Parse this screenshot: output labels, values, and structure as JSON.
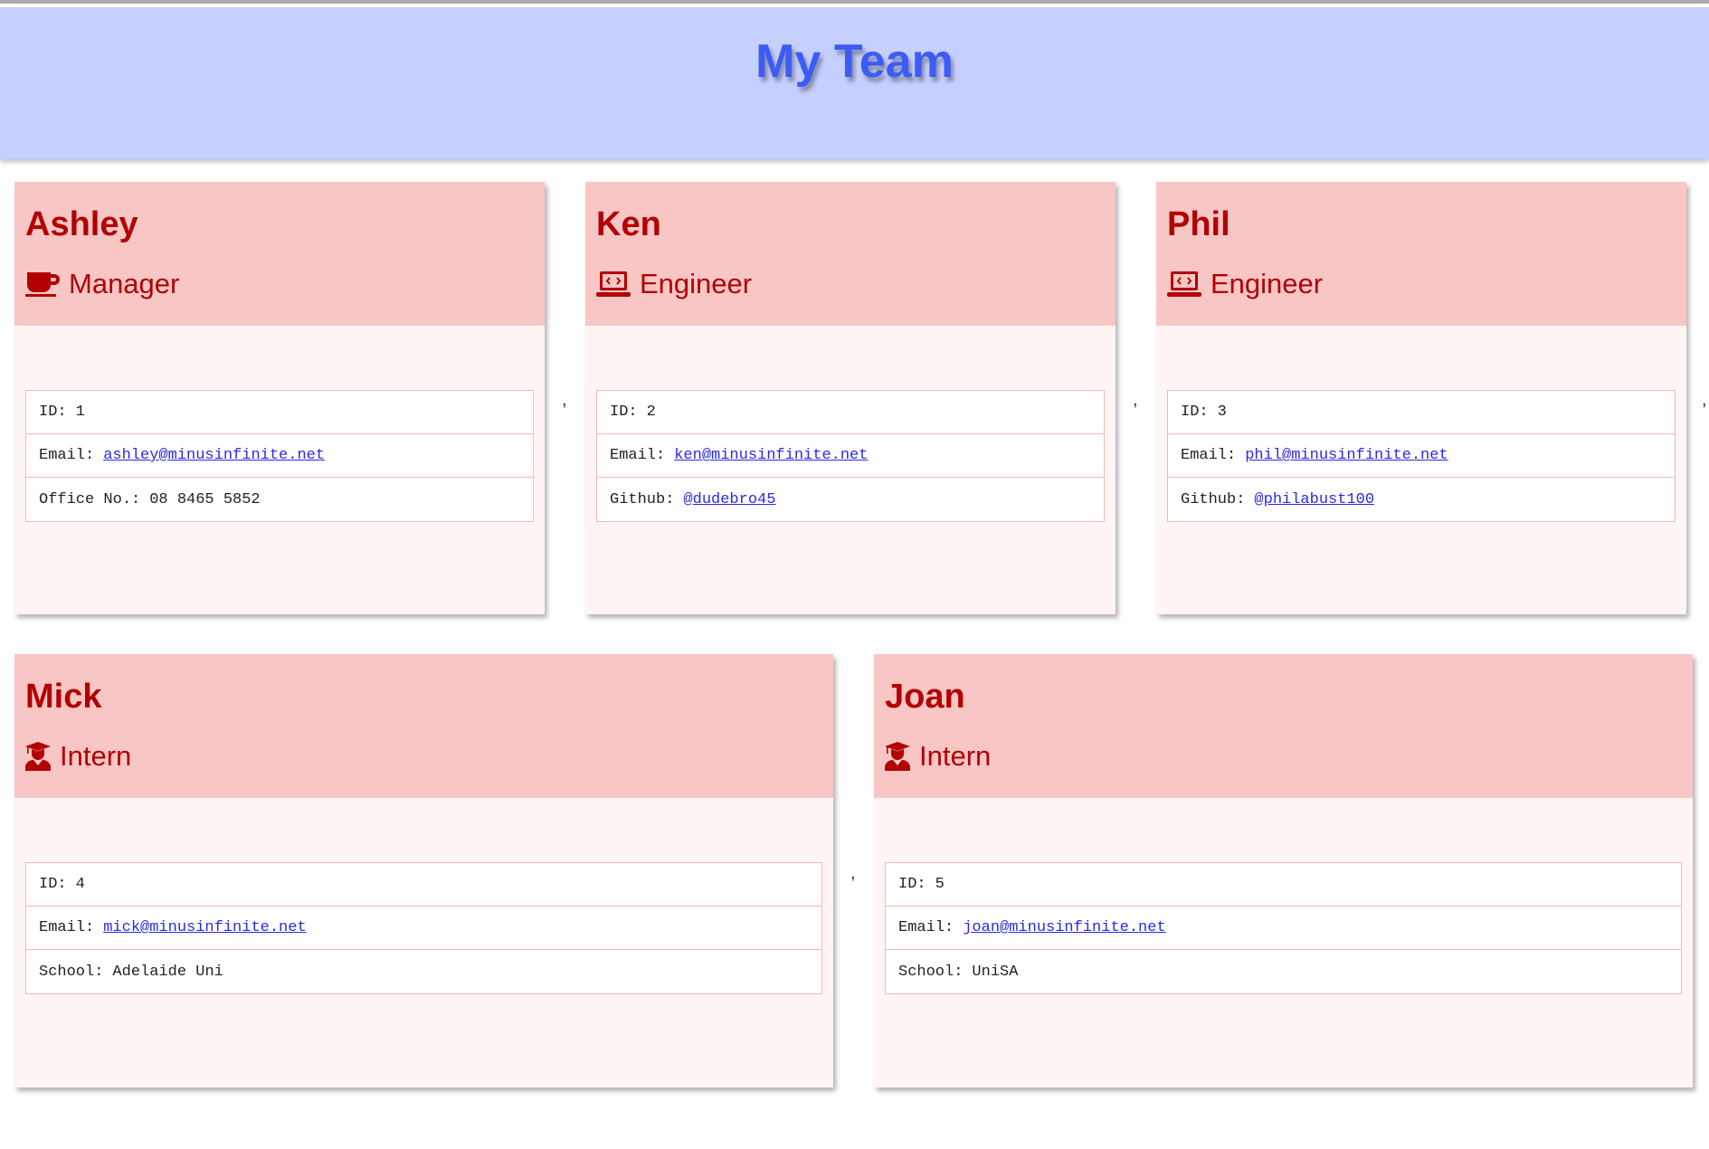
{
  "page": {
    "title": "My Team"
  },
  "separator": ",",
  "employees": [
    {
      "name": "Ashley",
      "role": "Manager",
      "role_icon": "coffee-icon",
      "id_label": "ID:",
      "id": "1",
      "email_label": "Email:",
      "email": "ashley@minusinfinite.net",
      "extra_label": "Office No.:",
      "extra_value": "08 8465 5852"
    },
    {
      "name": "Ken",
      "role": "Engineer",
      "role_icon": "laptop-code-icon",
      "id_label": "ID:",
      "id": "2",
      "email_label": "Email:",
      "email": "ken@minusinfinite.net",
      "extra_label": "Github:",
      "extra_value": "@dudebro45"
    },
    {
      "name": "Phil",
      "role": "Engineer",
      "role_icon": "laptop-code-icon",
      "id_label": "ID:",
      "id": "3",
      "email_label": "Email:",
      "email": "phil@minusinfinite.net",
      "extra_label": "Github:",
      "extra_value": "@philabust100"
    },
    {
      "name": "Mick",
      "role": "Intern",
      "role_icon": "graduate-icon",
      "id_label": "ID:",
      "id": "4",
      "email_label": "Email:",
      "email": "mick@minusinfinite.net",
      "extra_label": "School:",
      "extra_value": "Adelaide Uni"
    },
    {
      "name": "Joan",
      "role": "Intern",
      "role_icon": "graduate-icon",
      "id_label": "ID:",
      "id": "5",
      "email_label": "Email:",
      "email": "joan@minusinfinite.net",
      "extra_label": "School:",
      "extra_value": "UniSA"
    }
  ],
  "colors": {
    "header_bg": "#c5d0fe",
    "title": "#3d5cf5",
    "card_head": "#f9c6c6",
    "card_body": "#fff5f5",
    "accent": "#b30000",
    "link": "#2a2ae6"
  }
}
